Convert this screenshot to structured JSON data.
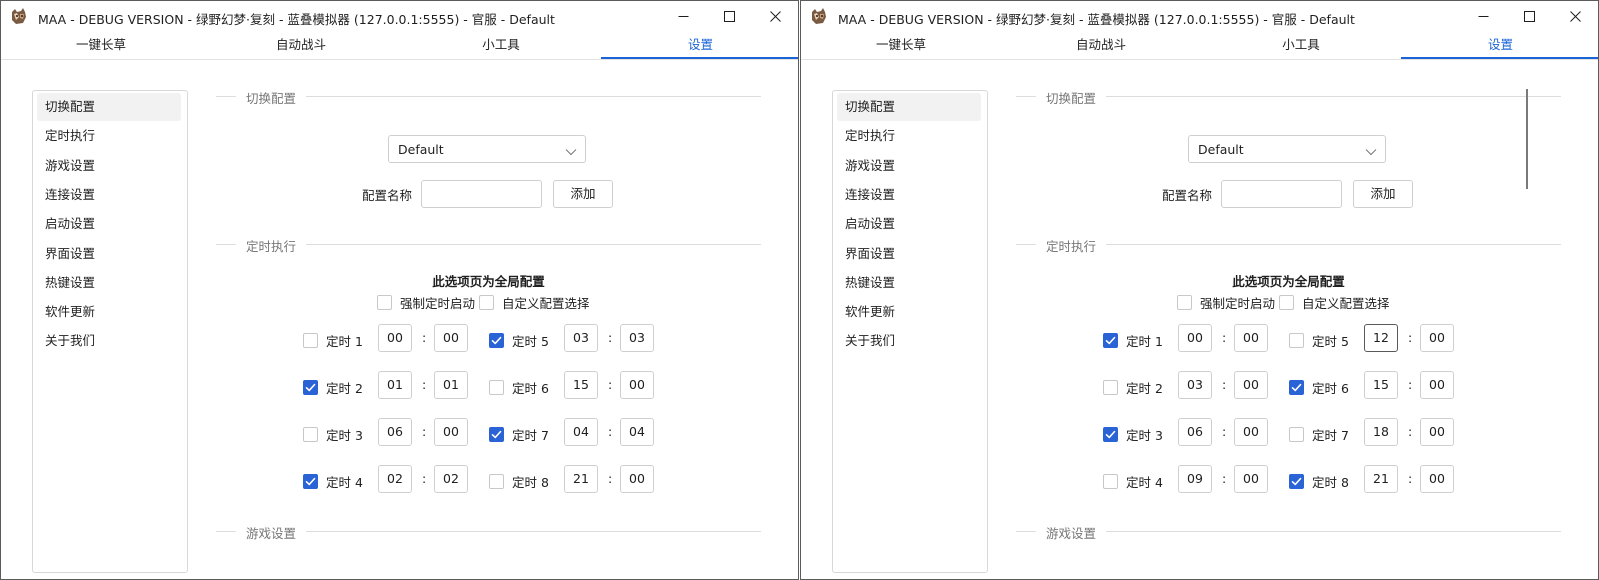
{
  "colors": {
    "accent": "#1a64d6",
    "checkbox_on": "#2a63d6"
  },
  "windows": [
    {
      "title": "MAA - DEBUG VERSION - 绿野幻梦·复刻 - 蓝叠模拟器 (127.0.0.1:5555) - 官服 - Default",
      "tabs": [
        "一键长草",
        "自动战斗",
        "小工具",
        "设置"
      ],
      "active_tab": 3,
      "sidebar": [
        "切换配置",
        "定时执行",
        "游戏设置",
        "连接设置",
        "启动设置",
        "界面设置",
        "热键设置",
        "软件更新",
        "关于我们"
      ],
      "sections": {
        "switch_config": "切换配置",
        "timer": "定时执行",
        "game": "游戏设置"
      },
      "config_dropdown": "Default",
      "config_name_label": "配置名称",
      "config_name_value": "",
      "add_button": "添加",
      "global_note": "此选项页为全局配置",
      "force_start_label": "强制定时启动",
      "force_start_checked": false,
      "custom_config_label": "自定义配置选择",
      "custom_config_checked": false,
      "time_separator": ":",
      "timers": [
        {
          "label": "定时 1",
          "checked": false,
          "hour": "00",
          "minute": "00"
        },
        {
          "label": "定时 2",
          "checked": true,
          "hour": "01",
          "minute": "01"
        },
        {
          "label": "定时 3",
          "checked": false,
          "hour": "06",
          "minute": "00"
        },
        {
          "label": "定时 4",
          "checked": true,
          "hour": "02",
          "minute": "02"
        },
        {
          "label": "定时 5",
          "checked": true,
          "hour": "03",
          "minute": "03"
        },
        {
          "label": "定时 6",
          "checked": false,
          "hour": "15",
          "minute": "00"
        },
        {
          "label": "定时 7",
          "checked": true,
          "hour": "04",
          "minute": "04"
        },
        {
          "label": "定时 8",
          "checked": false,
          "hour": "21",
          "minute": "00"
        }
      ]
    },
    {
      "title": "MAA - DEBUG VERSION - 绿野幻梦·复刻 - 蓝叠模拟器 (127.0.0.1:5555) - 官服 - Default",
      "tabs": [
        "一键长草",
        "自动战斗",
        "小工具",
        "设置"
      ],
      "active_tab": 3,
      "sidebar": [
        "切换配置",
        "定时执行",
        "游戏设置",
        "连接设置",
        "启动设置",
        "界面设置",
        "热键设置",
        "软件更新",
        "关于我们"
      ],
      "sections": {
        "switch_config": "切换配置",
        "timer": "定时执行",
        "game": "游戏设置"
      },
      "config_dropdown": "Default",
      "config_name_label": "配置名称",
      "config_name_value": "",
      "add_button": "添加",
      "global_note": "此选项页为全局配置",
      "force_start_label": "强制定时启动",
      "force_start_checked": false,
      "custom_config_label": "自定义配置选择",
      "custom_config_checked": false,
      "time_separator": ":",
      "timers": [
        {
          "label": "定时 1",
          "checked": true,
          "hour": "00",
          "minute": "00"
        },
        {
          "label": "定时 2",
          "checked": false,
          "hour": "03",
          "minute": "00"
        },
        {
          "label": "定时 3",
          "checked": true,
          "hour": "06",
          "minute": "00"
        },
        {
          "label": "定时 4",
          "checked": false,
          "hour": "09",
          "minute": "00"
        },
        {
          "label": "定时 5",
          "checked": false,
          "hour": "12",
          "minute": "00",
          "hour_focused": true
        },
        {
          "label": "定时 6",
          "checked": true,
          "hour": "15",
          "minute": "00"
        },
        {
          "label": "定时 7",
          "checked": false,
          "hour": "18",
          "minute": "00"
        },
        {
          "label": "定时 8",
          "checked": true,
          "hour": "21",
          "minute": "00"
        }
      ]
    }
  ]
}
